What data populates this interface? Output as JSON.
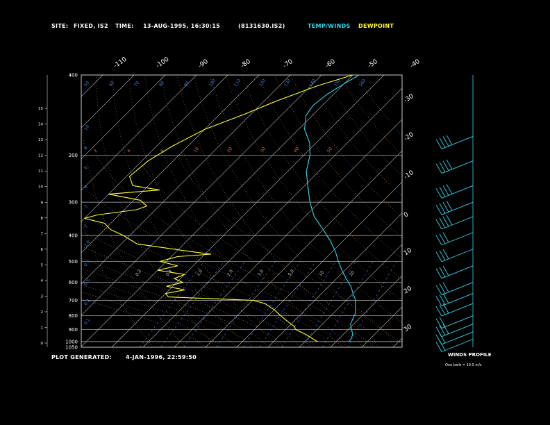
{
  "header": {
    "site_label": "SITE:",
    "site_value": "FIXED, IS2",
    "time_label": "TIME:",
    "time_value": "13-AUG-1995, 16:30:15",
    "file_id": "(8131630.IS2)",
    "legend_temp": "TEMP/WINDS",
    "legend_dew": "DEWPOINT"
  },
  "footer": {
    "generated_label": "PLOT GENERATED:",
    "generated_value": "4-JAN-1996, 22:59:50"
  },
  "wind_profile": {
    "title": "WINDS PROFILE",
    "note": "One barb = 10.0 m/s"
  },
  "colors": {
    "temp": "#33d6e6",
    "dew": "#ffff33",
    "isobar": "#bbbbbb",
    "isotherm": "#cccccc",
    "dry_adiabat": "#d08040",
    "mixing_ratio": "#4a7fd0",
    "moist_adiabat": "#c8c8c8"
  },
  "chart_data": {
    "type": "line",
    "chart_kind": "skew-T log-P thermodynamic diagram",
    "y_pressure_ticks": [
      400,
      200,
      300,
      400,
      500,
      600,
      700,
      800,
      900,
      1000,
      1050
    ],
    "y_pressure_levels": [
      400,
      200,
      300,
      400,
      500,
      600,
      700,
      800,
      900,
      1000,
      1050
    ],
    "y_height_ticks": [
      "15",
      "14",
      "13",
      "12",
      "11",
      "10",
      "9",
      "8",
      "7",
      "6",
      "5",
      "4",
      "3",
      "2",
      "1",
      "0"
    ],
    "top_temp_ticks": [
      "-110",
      "-100",
      "-90",
      "-80",
      "-70",
      "-60",
      "-50",
      "-40"
    ],
    "right_temp_ticks": [
      "-30",
      "-20",
      "-10",
      "0",
      "10",
      "20",
      "30"
    ],
    "mixing_ratio_labels": [
      "10",
      "8",
      "6",
      "4",
      "3",
      "2",
      "1.0",
      "0.5",
      "0.3",
      "0.2",
      "0.1"
    ],
    "moist_labels": [
      "50",
      "60",
      "70",
      "80",
      "90",
      "100",
      "110",
      "120",
      "130",
      "140",
      "150",
      "160"
    ],
    "dry_labels": [
      "2",
      "4",
      "6",
      "10",
      "20",
      "30",
      "40",
      "50"
    ],
    "inner_labels": [
      "0.2",
      "0.4",
      "1.0",
      "2.0",
      "3.0",
      "5.0",
      "10",
      "20"
    ],
    "series": [
      {
        "name": "TEMP/WINDS",
        "color": "#33d6e6",
        "points": [
          [
            100,
            -58
          ],
          [
            108,
            -60
          ],
          [
            118,
            -62
          ],
          [
            130,
            -63
          ],
          [
            142,
            -62
          ],
          [
            160,
            -58
          ],
          [
            180,
            -52
          ],
          [
            200,
            -48
          ],
          [
            230,
            -44
          ],
          [
            260,
            -39
          ],
          [
            300,
            -33
          ],
          [
            340,
            -27
          ],
          [
            380,
            -20
          ],
          [
            420,
            -14
          ],
          [
            460,
            -9
          ],
          [
            500,
            -5
          ],
          [
            540,
            -1
          ],
          [
            580,
            3
          ],
          [
            620,
            7
          ],
          [
            660,
            10
          ],
          [
            700,
            13
          ],
          [
            740,
            15
          ],
          [
            780,
            17
          ],
          [
            820,
            18
          ],
          [
            860,
            19
          ],
          [
            900,
            21
          ],
          [
            940,
            23
          ],
          [
            980,
            24
          ],
          [
            1000,
            24
          ]
        ]
      },
      {
        "name": "DEWPOINT",
        "color": "#ffff33",
        "points": [
          [
            100,
            -60
          ],
          [
            110,
            -68
          ],
          [
            125,
            -76
          ],
          [
            140,
            -82
          ],
          [
            160,
            -90
          ],
          [
            185,
            -95
          ],
          [
            210,
            -98
          ],
          [
            240,
            -99
          ],
          [
            260,
            -95
          ],
          [
            270,
            -85
          ],
          [
            280,
            -100
          ],
          [
            295,
            -88
          ],
          [
            310,
            -84
          ],
          [
            320,
            -86
          ],
          [
            335,
            -97
          ],
          [
            345,
            -100
          ],
          [
            360,
            -92
          ],
          [
            380,
            -88
          ],
          [
            400,
            -82
          ],
          [
            430,
            -75
          ],
          [
            460,
            -55
          ],
          [
            470,
            -48
          ],
          [
            480,
            -58
          ],
          [
            500,
            -62
          ],
          [
            520,
            -55
          ],
          [
            540,
            -60
          ],
          [
            560,
            -50
          ],
          [
            580,
            -52
          ],
          [
            600,
            -48
          ],
          [
            620,
            -52
          ],
          [
            640,
            -45
          ],
          [
            660,
            -50
          ],
          [
            680,
            -48
          ],
          [
            700,
            -20
          ],
          [
            720,
            -15
          ],
          [
            760,
            -10
          ],
          [
            800,
            -6
          ],
          [
            840,
            -2
          ],
          [
            880,
            2
          ],
          [
            900,
            3
          ],
          [
            940,
            8
          ],
          [
            980,
            12
          ],
          [
            1000,
            14
          ]
        ]
      }
    ],
    "wind_barbs": [
      {
        "p": 170,
        "dir": 295,
        "speed": 35
      },
      {
        "p": 210,
        "dir": 300,
        "speed": 40
      },
      {
        "p": 260,
        "dir": 290,
        "speed": 40
      },
      {
        "p": 300,
        "dir": 285,
        "speed": 35
      },
      {
        "p": 340,
        "dir": 280,
        "speed": 35
      },
      {
        "p": 390,
        "dir": 275,
        "speed": 30
      },
      {
        "p": 450,
        "dir": 270,
        "speed": 30
      },
      {
        "p": 520,
        "dir": 270,
        "speed": 30
      },
      {
        "p": 600,
        "dir": 280,
        "speed": 25
      },
      {
        "p": 660,
        "dir": 285,
        "speed": 25
      },
      {
        "p": 720,
        "dir": 290,
        "speed": 25
      },
      {
        "p": 800,
        "dir": 295,
        "speed": 20
      },
      {
        "p": 860,
        "dir": 300,
        "speed": 25
      },
      {
        "p": 920,
        "dir": 305,
        "speed": 20
      },
      {
        "p": 980,
        "dir": 310,
        "speed": 15
      }
    ]
  }
}
